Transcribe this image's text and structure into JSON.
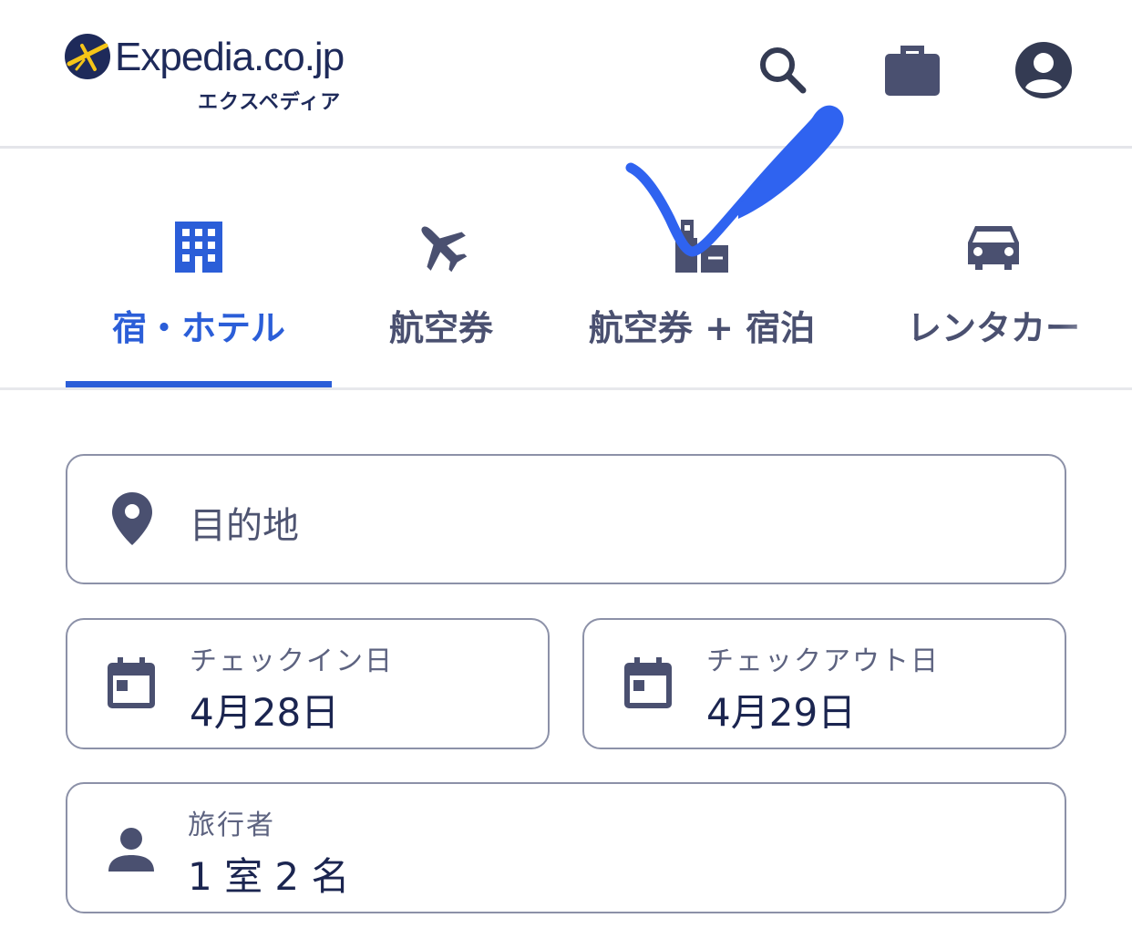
{
  "header": {
    "logo_text": "Expedia.co.jp",
    "logo_subtext": "エクスペディア",
    "icons": [
      "search-icon",
      "briefcase-icon",
      "account-icon"
    ]
  },
  "tabs": [
    {
      "label": "宿・ホテル",
      "icon": "hotel-icon",
      "active": true
    },
    {
      "label": "航空券",
      "icon": "plane-icon",
      "active": false
    },
    {
      "label": "航空券 + 宿泊",
      "icon": "package-icon",
      "active": false
    },
    {
      "label": "レンタカー",
      "icon": "car-icon",
      "active": false
    }
  ],
  "form": {
    "destination": {
      "placeholder": "目的地",
      "icon": "location-pin-icon"
    },
    "checkin": {
      "label": "チェックイン日",
      "value": "4月28日",
      "icon": "calendar-icon"
    },
    "checkout": {
      "label": "チェックアウト日",
      "value": "4月29日",
      "icon": "calendar-icon"
    },
    "travelers": {
      "label": "旅行者",
      "value": "1 室 2 名",
      "icon": "person-icon"
    }
  },
  "colors": {
    "accent": "#2b5ed8",
    "icon": "#4a5070",
    "border": "#8c91a8",
    "annotation_stroke": "#2f63f0"
  }
}
